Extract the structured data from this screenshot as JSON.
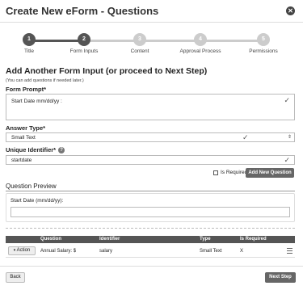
{
  "header": {
    "title": "Create New eForm - Questions",
    "close_icon": "close-icon"
  },
  "wizard": {
    "steps": [
      {
        "number": "1",
        "label": "Title",
        "state": "done"
      },
      {
        "number": "2",
        "label": "Form Inputs",
        "state": "active"
      },
      {
        "number": "3",
        "label": "Content",
        "state": "todo"
      },
      {
        "number": "4",
        "label": "Approval Process",
        "state": "todo"
      },
      {
        "number": "5",
        "label": "Permissions",
        "state": "todo"
      }
    ]
  },
  "form": {
    "section_title": "Add Another Form Input (or proceed to Next Step)",
    "section_note": "(You can add questions if needed later.)",
    "prompt_label": "Form Prompt*",
    "prompt_value": "Start Date  mm/dd/yy :",
    "answer_type_label": "Answer Type*",
    "answer_type_value": "Small Text",
    "identifier_label": "Unique Identifier*",
    "identifier_value": "startdate",
    "is_required_label": "Is Required?",
    "add_button": "Add New Question"
  },
  "preview": {
    "title": "Question Preview",
    "field_label": "Start Date (mm/dd/yy):"
  },
  "table": {
    "headers": [
      "Question",
      "Identifier",
      "Type",
      "Is Required"
    ],
    "rows": [
      {
        "action": "Action",
        "question": "Annual Salary: $",
        "identifier": "salary",
        "type": "Small Text",
        "required": "X"
      }
    ]
  },
  "footer": {
    "back": "Back",
    "next": "Next Step"
  },
  "colors": {
    "done_step": "#555555",
    "active_step": "#555555",
    "todo_step": "#cccccc",
    "button_dark": "#666666"
  }
}
